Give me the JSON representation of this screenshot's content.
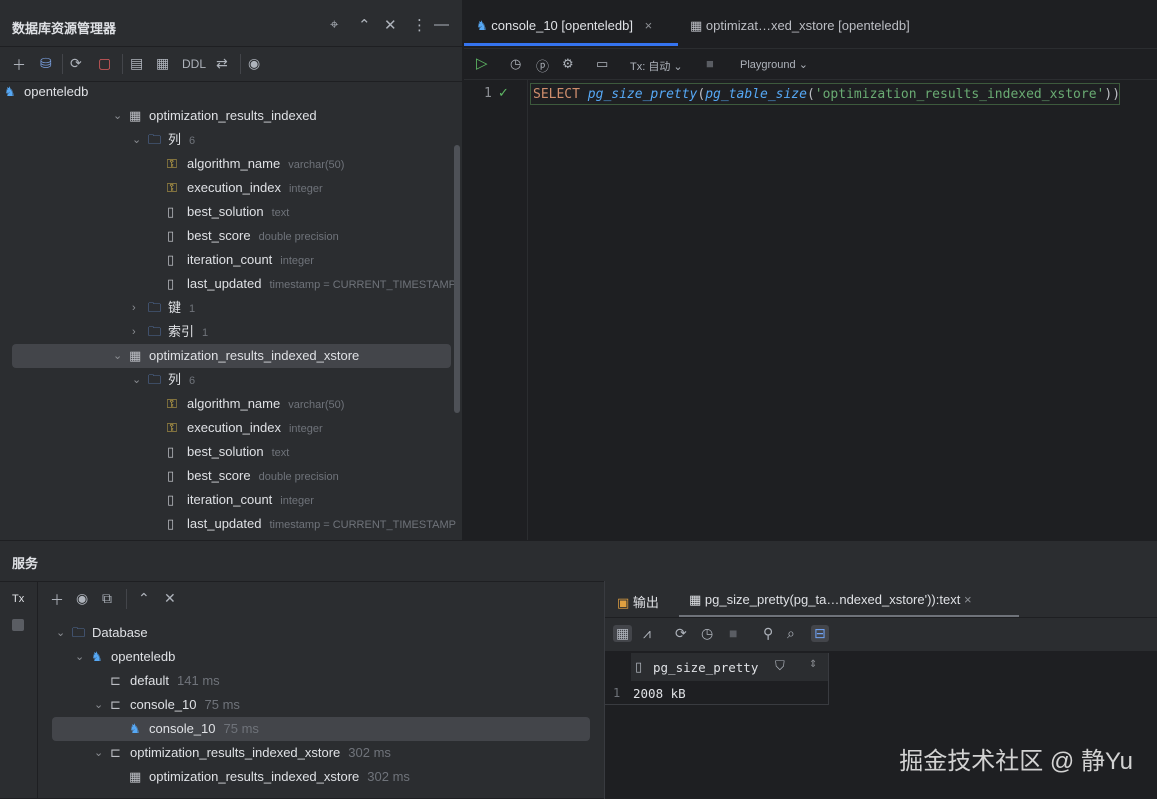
{
  "explorer": {
    "title": "数据库资源管理器",
    "toolbar_ddl": "DDL",
    "rows": [
      {
        "depth": 0,
        "icon": "postgres",
        "label": "openteledb"
      },
      {
        "depth": 1,
        "icon": "table",
        "label": "optimization_results_indexed",
        "open": true
      },
      {
        "depth": 2,
        "icon": "folder",
        "label": "列",
        "hint": "6",
        "open": true
      },
      {
        "depth": 3,
        "icon": "key-column",
        "label": "algorithm_name",
        "hint": "varchar(50)"
      },
      {
        "depth": 3,
        "icon": "key-column",
        "label": "execution_index",
        "hint": "integer"
      },
      {
        "depth": 3,
        "icon": "column",
        "label": "best_solution",
        "hint": "text"
      },
      {
        "depth": 3,
        "icon": "column",
        "label": "best_score",
        "hint": "double precision"
      },
      {
        "depth": 3,
        "icon": "column",
        "label": "iteration_count",
        "hint": "integer"
      },
      {
        "depth": 3,
        "icon": "column",
        "label": "last_updated",
        "hint": "timestamp = CURRENT_TIMESTAMP"
      },
      {
        "depth": 2,
        "icon": "folder",
        "label": "键",
        "hint": "1",
        "open": false
      },
      {
        "depth": 2,
        "icon": "folder",
        "label": "索引",
        "hint": "1",
        "open": false
      },
      {
        "depth": 1,
        "icon": "table",
        "label": "optimization_results_indexed_xstore",
        "open": true,
        "selected": true
      },
      {
        "depth": 2,
        "icon": "folder",
        "label": "列",
        "hint": "6",
        "open": true
      },
      {
        "depth": 3,
        "icon": "key-column",
        "label": "algorithm_name",
        "hint": "varchar(50)"
      },
      {
        "depth": 3,
        "icon": "key-column",
        "label": "execution_index",
        "hint": "integer"
      },
      {
        "depth": 3,
        "icon": "column",
        "label": "best_solution",
        "hint": "text"
      },
      {
        "depth": 3,
        "icon": "column",
        "label": "best_score",
        "hint": "double precision"
      },
      {
        "depth": 3,
        "icon": "column",
        "label": "iteration_count",
        "hint": "integer"
      },
      {
        "depth": 3,
        "icon": "column",
        "label": "last_updated",
        "hint": "timestamp = CURRENT_TIMESTAMP"
      }
    ]
  },
  "editor": {
    "tabs": [
      {
        "label": "console_10 [openteledb]",
        "active": true
      },
      {
        "label": "optimizat…xed_xstore [openteledb]"
      }
    ],
    "tx": "Tx: 自动",
    "playground": "Playground",
    "line_number": "1",
    "code": {
      "kw": "SELECT",
      "f1": "pg_size_pretty",
      "p1": "(",
      "f2": "pg_table_size",
      "p2": "(",
      "str": "'optimization_results_indexed_xstore'",
      "p3": "));"
    }
  },
  "services": {
    "title": "服务",
    "tx_label": "Tx",
    "rows": [
      {
        "depth": 0,
        "icon": "folder",
        "label": "Database",
        "open": true
      },
      {
        "depth": 1,
        "icon": "postgres",
        "label": "openteledb",
        "open": true
      },
      {
        "depth": 2,
        "icon": "session",
        "label": "default",
        "hint": "141 ms"
      },
      {
        "depth": 2,
        "icon": "session",
        "label": "console_10",
        "hint": "75 ms",
        "open": true
      },
      {
        "depth": 3,
        "icon": "postgres",
        "label": "console_10",
        "hint": "75 ms",
        "selected": true
      },
      {
        "depth": 2,
        "icon": "session",
        "label": "optimization_results_indexed_xstore",
        "hint": "302 ms",
        "open": true
      },
      {
        "depth": 3,
        "icon": "table",
        "label": "optimization_results_indexed_xstore",
        "hint": "302 ms"
      }
    ]
  },
  "results": {
    "output_tab": "输出",
    "result_tab": "pg_size_pretty(pg_ta…ndexed_xstore')):text",
    "columns": [
      "pg_size_pretty"
    ],
    "rows": [
      {
        "num": "1",
        "values": [
          "2008 kB"
        ]
      }
    ]
  },
  "watermark": "掘金技术社区 @ 静Yu"
}
